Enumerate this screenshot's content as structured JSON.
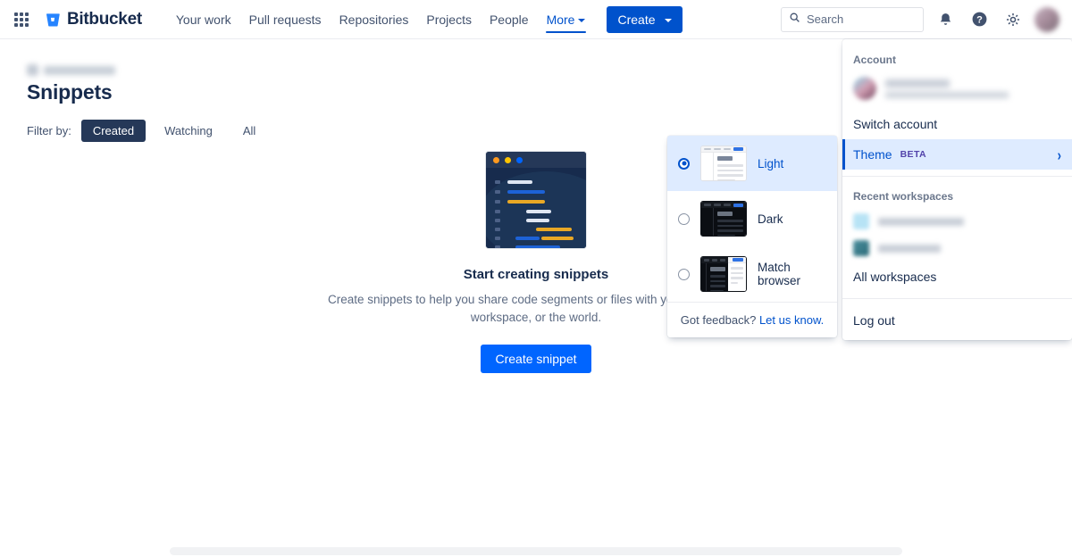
{
  "header": {
    "app_switcher_icon": "grid-apps-icon",
    "brand": "Bitbucket",
    "brand_icon": "bitbucket-bucket-logo",
    "nav": [
      {
        "label": "Your work",
        "active": false,
        "has_caret": false
      },
      {
        "label": "Pull requests",
        "active": false,
        "has_caret": false
      },
      {
        "label": "Repositories",
        "active": false,
        "has_caret": false
      },
      {
        "label": "Projects",
        "active": false,
        "has_caret": false
      },
      {
        "label": "People",
        "active": false,
        "has_caret": false
      },
      {
        "label": "More",
        "active": true,
        "has_caret": true
      }
    ],
    "create_label": "Create",
    "search": {
      "placeholder": "Search",
      "value": "",
      "icon": "search-icon"
    },
    "notifications_icon": "notification-bell-icon",
    "help_icon": "help-question-icon",
    "settings_icon": "gear-icon",
    "avatar_icon": "user-avatar"
  },
  "page": {
    "breadcrumb": "",
    "title": "Snippets",
    "filter_label": "Filter by:",
    "filters": [
      {
        "label": "Created",
        "selected": true
      },
      {
        "label": "Watching",
        "selected": false
      },
      {
        "label": "All",
        "selected": false
      }
    ]
  },
  "empty_state": {
    "illustration_icon": "code-snippet-window-illustration",
    "title": "Start creating snippets",
    "description": "Create snippets to help you share code segments or files with your team, your workspace, or the world.",
    "cta_label": "Create snippet"
  },
  "account_menu": {
    "account_section_title": "Account",
    "account_name": "",
    "account_email": "",
    "switch_account_label": "Switch account",
    "theme_label": "Theme",
    "theme_badge": "BETA",
    "theme_chevron_icon": "chevron-right-icon",
    "recent_workspaces_title": "Recent workspaces",
    "workspaces": [
      {
        "name": ""
      },
      {
        "name": ""
      }
    ],
    "all_workspaces_label": "All workspaces",
    "log_out_label": "Log out"
  },
  "theme_panel": {
    "options": [
      {
        "label": "Light",
        "selected": true,
        "thumb": "light-theme-preview"
      },
      {
        "label": "Dark",
        "selected": false,
        "thumb": "dark-theme-preview"
      },
      {
        "label": "Match browser",
        "selected": false,
        "thumb": "match-browser-theme-preview"
      }
    ],
    "feedback_text": "Got feedback?",
    "feedback_link": "Let us know."
  },
  "colors": {
    "brand_blue": "#0052CC",
    "button_blue": "#0065FF",
    "selected_bg": "#DEEBFF",
    "filter_selected_bg": "#253858",
    "beta_purple": "#5243AA",
    "text_primary": "#172B4D",
    "text_subtle": "#5E6C84",
    "illustration_navy": "#172B4D",
    "illustration_orange": "#FF991F",
    "illustration_yellow": "#FFC400",
    "illustration_blue": "#0065FF"
  }
}
